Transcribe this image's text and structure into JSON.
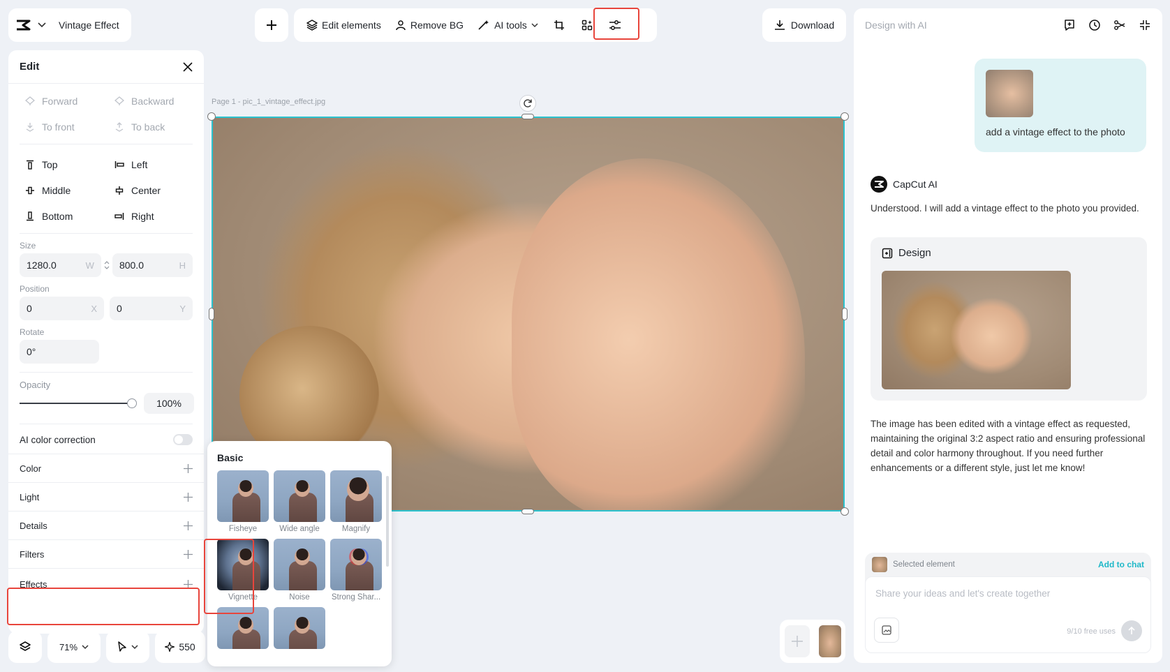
{
  "app": {
    "project_title": "Vintage Effect"
  },
  "toolbar": {
    "edit_elements": "Edit elements",
    "remove_bg": "Remove BG",
    "ai_tools": "AI tools",
    "download": "Download"
  },
  "edit_panel": {
    "title": "Edit",
    "arrange": [
      {
        "label": "Forward",
        "disabled": true
      },
      {
        "label": "Backward",
        "disabled": true
      },
      {
        "label": "To front",
        "disabled": true
      },
      {
        "label": "To back",
        "disabled": true
      }
    ],
    "align": [
      {
        "label": "Top"
      },
      {
        "label": "Left"
      },
      {
        "label": "Middle"
      },
      {
        "label": "Center"
      },
      {
        "label": "Bottom"
      },
      {
        "label": "Right"
      }
    ],
    "size_label": "Size",
    "width": "1280.0",
    "width_suffix": "W",
    "height": "800.0",
    "height_suffix": "H",
    "position_label": "Position",
    "pos_x": "0",
    "pos_x_suffix": "X",
    "pos_y": "0",
    "pos_y_suffix": "Y",
    "rotate_label": "Rotate",
    "rotate": "0°",
    "opacity_label": "Opacity",
    "opacity": "100%",
    "opacity_value": 100,
    "ai_color_correction": "AI color correction",
    "ai_color_correction_on": false,
    "sections": [
      "Color",
      "Light",
      "Details",
      "Filters",
      "Effects"
    ]
  },
  "bottom_controls": {
    "zoom": "71%",
    "credits": "550"
  },
  "canvas": {
    "page_label": "Page 1 -  pic_1_vintage_effect.jpg"
  },
  "effects_popover": {
    "title": "Basic",
    "items": [
      "Fisheye",
      "Wide angle",
      "Magnify",
      "Vignette",
      "Noise",
      "Strong Shar..."
    ]
  },
  "ai_panel": {
    "title": "Design with AI",
    "user_message": "add a vintage effect to the photo",
    "assistant_name": "CapCut AI",
    "assistant_reply_1": "Understood. I will add a vintage effect to the photo you provided.",
    "design_card_title": "Design",
    "assistant_reply_2": "The image has been edited with a vintage effect as requested, maintaining the original 3:2 aspect ratio and ensuring professional detail and color harmony throughout. If you need further enhancements or a different style, just let me know!",
    "selected_element": "Selected element",
    "add_to_chat": "Add to chat",
    "input_placeholder": "Share your ideas and let's create together",
    "free_uses": "9/10 free uses"
  },
  "colors": {
    "accent": "#2bc3cf",
    "highlight": "#e8453c",
    "link": "#1fb8c8"
  }
}
